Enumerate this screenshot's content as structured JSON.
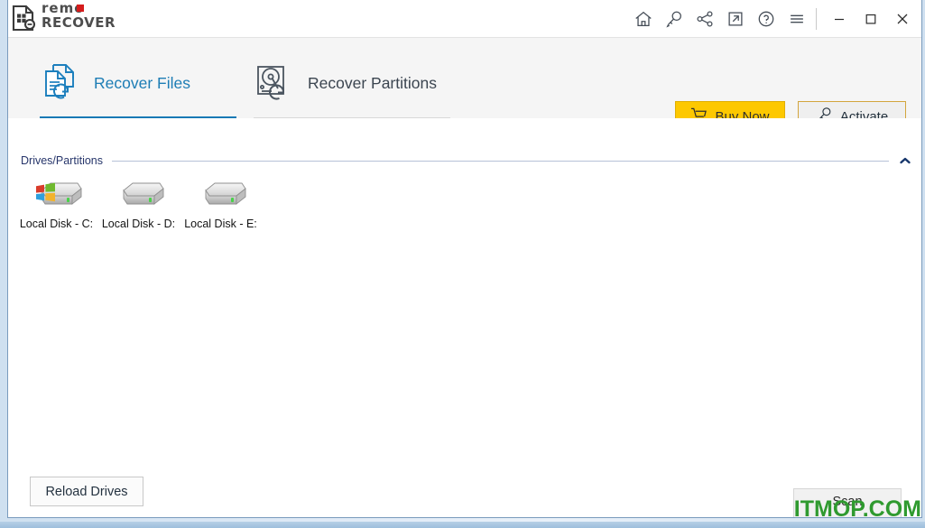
{
  "window": {
    "logo": {
      "icon": "document-refresh-icon",
      "line1": "remo",
      "line2": "RECOVER"
    },
    "title_actions": [
      {
        "name": "home-icon",
        "label": "Home"
      },
      {
        "name": "key-icon",
        "label": "Key"
      },
      {
        "name": "share-icon",
        "label": "Share"
      },
      {
        "name": "external-link-icon",
        "label": "Open External"
      },
      {
        "name": "help-icon",
        "label": "Help"
      },
      {
        "name": "hamburger-menu-icon",
        "label": "Menu"
      }
    ],
    "controls": [
      {
        "name": "minimize-button",
        "glyph": "─"
      },
      {
        "name": "maximize-button",
        "glyph": "□"
      },
      {
        "name": "close-button",
        "glyph": "✕"
      }
    ]
  },
  "tabs": [
    {
      "id": "recover-files",
      "label": "Recover Files",
      "icon": "files-refresh-icon",
      "active": true
    },
    {
      "id": "recover-partitions",
      "label": "Recover Partitions",
      "icon": "disk-refresh-icon",
      "active": false
    }
  ],
  "actions": {
    "buy_now": {
      "label": "Buy Now",
      "icon": "shopping-cart-icon",
      "color": "#fdc800"
    },
    "activate": {
      "label": "Activate",
      "icon": "key-icon",
      "border_color": "#d3a63e"
    }
  },
  "main": {
    "section": {
      "title": "Drives/Partitions",
      "collapse_icon": "chevron-up-icon",
      "title_color": "#27366b"
    },
    "drives": [
      {
        "label": "Local Disk - C:",
        "icon": "hard-drive-windows-icon",
        "system": true
      },
      {
        "label": "Local Disk - D:",
        "icon": "hard-drive-icon",
        "system": false
      },
      {
        "label": "Local Disk - E:",
        "icon": "hard-drive-icon",
        "system": false
      }
    ]
  },
  "footer": {
    "reload_drives": {
      "label": "Reload Drives"
    },
    "scan": {
      "label": "Scan"
    }
  },
  "watermark": {
    "text": "ITMOP.COM",
    "color": "#2f9a2f"
  }
}
